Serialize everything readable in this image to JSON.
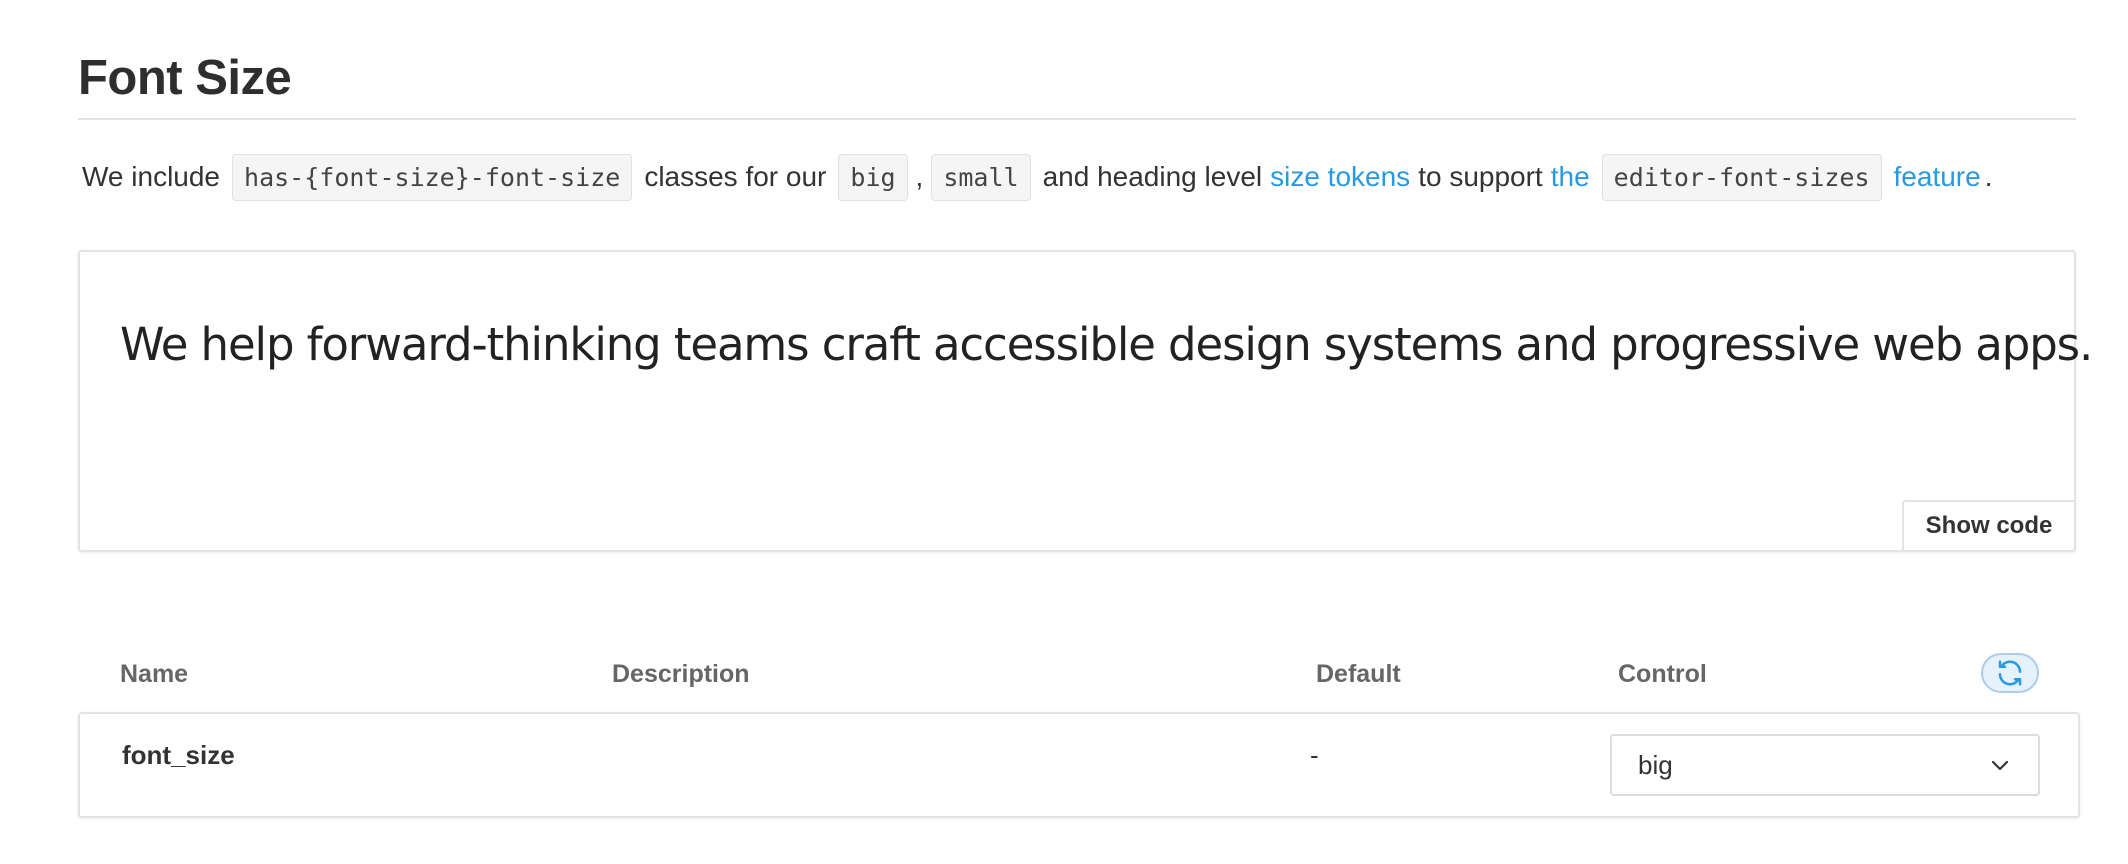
{
  "section": {
    "title": "Font Size"
  },
  "intro": {
    "t1": "We include",
    "code1": "has-{font-size}-font-size",
    "t2": "classes for our",
    "code2": "big",
    "t3": ",",
    "code3": "small",
    "t4": "and heading level",
    "link1": "size tokens",
    "t5": "to support",
    "link2": "the",
    "code4": "editor-font-sizes",
    "link3": "feature",
    "t6": "."
  },
  "preview": {
    "text": "We help forward-thinking teams craft accessible design systems and progressive web apps.",
    "show_code_label": "Show code"
  },
  "args_table": {
    "headers": {
      "name": "Name",
      "description": "Description",
      "default": "Default",
      "control": "Control"
    },
    "reset_icon": "reset-icon",
    "rows": [
      {
        "name": "font_size",
        "description": "",
        "default": "-",
        "control_value": "big"
      }
    ]
  },
  "colors": {
    "link": "#2a9adf",
    "reset_bg": "#e5f1fb",
    "reset_icon": "#2a9adf",
    "border": "#e3e3e3"
  }
}
